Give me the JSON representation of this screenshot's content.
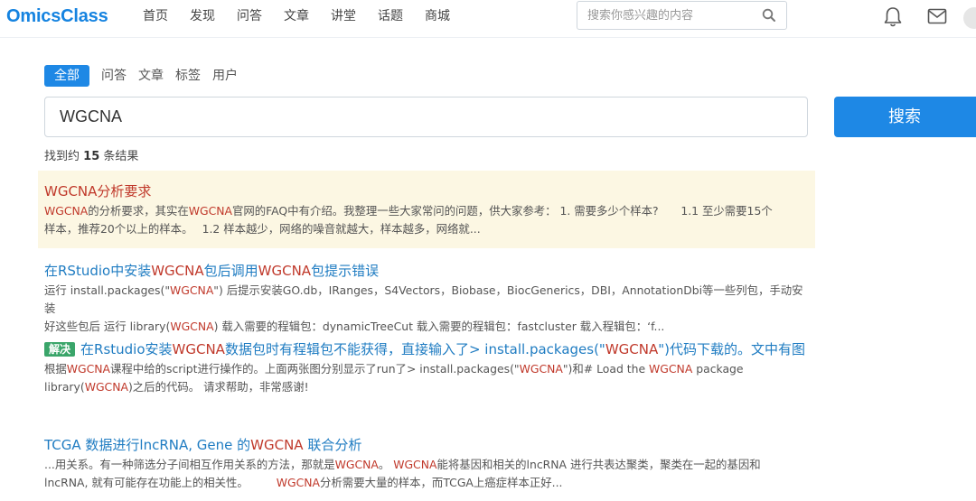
{
  "header": {
    "logo": "OmicsClass",
    "nav": [
      "首页",
      "发现",
      "问答",
      "文章",
      "讲堂",
      "话题",
      "商城"
    ],
    "search_placeholder": "搜索你感兴趣的内容"
  },
  "tabs": [
    "全部",
    "问答",
    "文章",
    "标签",
    "用户"
  ],
  "search": {
    "value": "WGCNA",
    "button": "搜索"
  },
  "results_count": {
    "prefix": "找到约",
    "number": "15",
    "suffix": "条结果"
  },
  "results": [
    {
      "title": [
        {
          "t": "WGCNA",
          "em": true
        },
        {
          "t": "分析要求",
          "em": true
        }
      ],
      "desc": [
        [
          {
            "t": "WGCNA",
            "em": true
          },
          {
            "t": "的分析要求，其实在",
            "em": false
          },
          {
            "t": "WGCNA",
            "em": true
          },
          {
            "t": "官网的FAQ中有介绍。我整理一些大家常问的问题，供大家参考： 1. 需要多少个样本?　　1.1 至少需要15个",
            "em": false
          }
        ],
        [
          {
            "t": "样本，推荐20个以上的样本。　 1.2 样本越少，网络的噪音就越大，样本越多，网络就...",
            "em": false
          }
        ]
      ]
    },
    {
      "title": [
        {
          "t": "在RStudio中安装",
          "em": false
        },
        {
          "t": "WGCNA",
          "em": true
        },
        {
          "t": "包后调用",
          "em": false
        },
        {
          "t": "WGCNA",
          "em": true
        },
        {
          "t": "包提示错误",
          "em": false
        }
      ],
      "desc": [
        [
          {
            "t": "运行 install.packages(\"",
            "em": false
          },
          {
            "t": "WGCNA",
            "em": true
          },
          {
            "t": "\") 后提示安装GO.db，IRanges，S4Vectors，Biobase，BiocGenerics，DBI，AnnotationDbi等一些列包，手动安装",
            "em": false
          }
        ],
        [
          {
            "t": "好这些包后 运行 library(",
            "em": false
          },
          {
            "t": "WGCNA",
            "em": true
          },
          {
            "t": ") 载入需要的程辑包：dynamicTreeCut 载入需要的程辑包：fastcluster 载入程辑包：‘f...",
            "em": false
          }
        ]
      ]
    },
    {
      "badge": "解决",
      "title": [
        {
          "t": "在Rstudio安装",
          "em": false
        },
        {
          "t": "WGCNA",
          "em": true
        },
        {
          "t": "数据包时有程辑包不能获得，直接输入了> install.packages(\"",
          "em": false
        },
        {
          "t": "WGCNA",
          "em": true
        },
        {
          "t": "\")代码下载的。文中有图",
          "em": false
        }
      ],
      "desc": [
        [
          {
            "t": "根据",
            "em": false
          },
          {
            "t": "WGCNA",
            "em": true
          },
          {
            "t": "课程中给的script进行操作的。上面两张图分别显示了run了> install.packages(\"",
            "em": false
          },
          {
            "t": "WGCNA",
            "em": true
          },
          {
            "t": "\")和# Load the ",
            "em": false
          },
          {
            "t": "WGCNA",
            "em": true
          },
          {
            "t": " package",
            "em": false
          }
        ],
        [
          {
            "t": "library(",
            "em": false
          },
          {
            "t": "WGCNA",
            "em": true
          },
          {
            "t": ")之后的代码。 请求帮助，非常感谢!",
            "em": false
          }
        ]
      ]
    },
    {
      "title": [
        {
          "t": "TCGA 数据进行lncRNA, Gene 的",
          "em": false
        },
        {
          "t": "WGCNA",
          "em": true
        },
        {
          "t": " 联合分析",
          "em": false
        }
      ],
      "desc": [
        [
          {
            "t": "...用关系。有一种筛选分子间相互作用关系的方法，那就是",
            "em": false
          },
          {
            "t": "WGCNA",
            "em": true
          },
          {
            "t": "。 ",
            "em": false
          },
          {
            "t": "WGCNA",
            "em": true
          },
          {
            "t": "能将基因和相关的lncRNA 进行共表达聚类，聚类在一起的基因和",
            "em": false
          }
        ],
        [
          {
            "t": "lncRNA, 就有可能存在功能上的相关性。　　　",
            "em": false
          },
          {
            "t": "WGCNA",
            "em": true
          },
          {
            "t": "分析需要大量的样本，而TCGA上癌症样本正好...",
            "em": false
          }
        ]
      ]
    }
  ]
}
